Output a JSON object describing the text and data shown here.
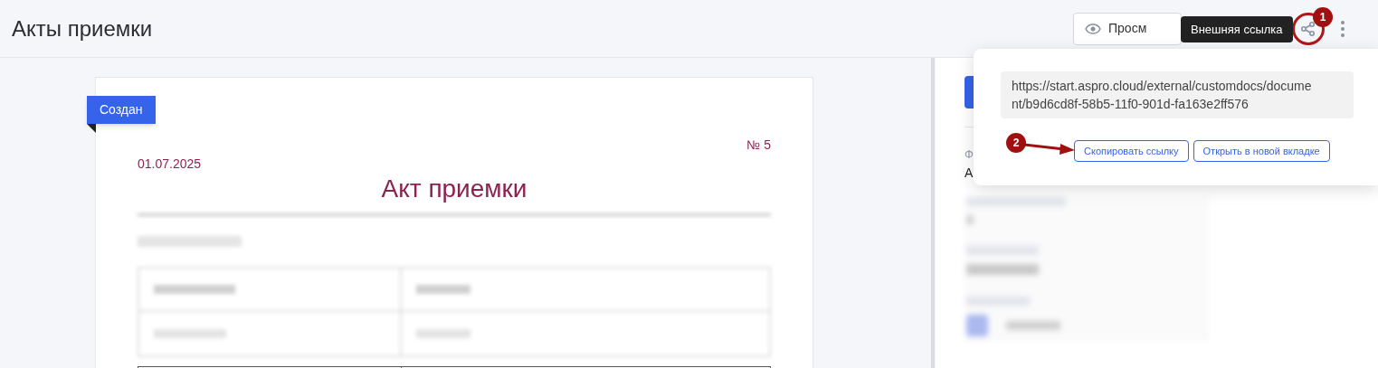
{
  "header": {
    "title": "Акты приемки",
    "view_button": "Просм"
  },
  "tooltip": {
    "text": "Внешняя ссылка"
  },
  "markers": [
    {
      "label": "1"
    },
    {
      "label": "2"
    }
  ],
  "popover": {
    "url": "https://start.aspro.cloud/external/customdocs/document/b9d6cd8f-58b5-11f0-901d-fa163e2ff576",
    "buttons": [
      "Скопировать ссылку",
      "Открыть в новой вкладке"
    ]
  },
  "document": {
    "status": "Создан",
    "date": "01.07.2025",
    "number": "№ 5",
    "title": "Акт приемки"
  },
  "side_panel": {
    "field_label": "Ф",
    "field_value": "А"
  }
}
